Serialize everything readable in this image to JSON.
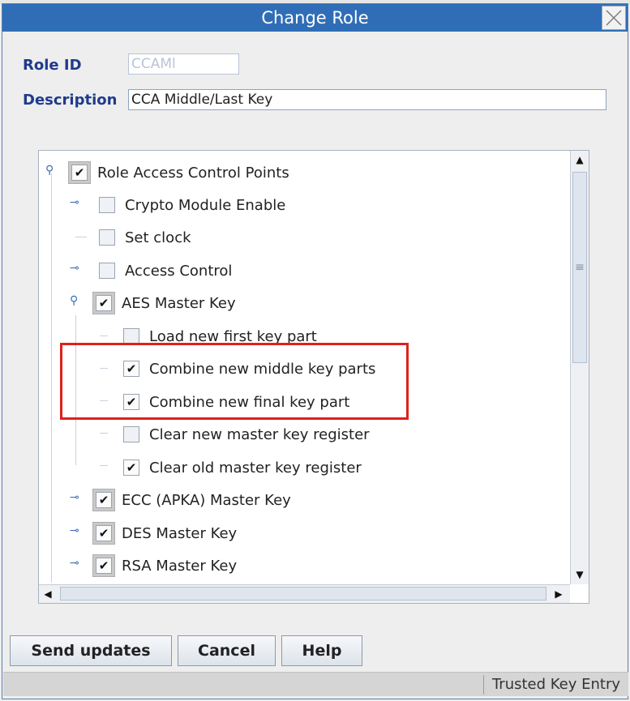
{
  "dialog": {
    "title": "Change Role",
    "role_id_label": "Role ID",
    "role_id_value": "CCAMl",
    "description_label": "Description",
    "description_value": "CCA Middle/Last Key"
  },
  "tree": {
    "root": "Role Access Control Points",
    "items": [
      {
        "label": "Crypto Module Enable",
        "checked": false
      },
      {
        "label": "Set clock",
        "checked": false
      },
      {
        "label": "Access Control",
        "checked": false
      },
      {
        "label": "AES Master Key",
        "checked": true
      },
      {
        "label": "Load new first key part",
        "checked": false
      },
      {
        "label": "Combine new middle key parts",
        "checked": true
      },
      {
        "label": "Combine new final key part",
        "checked": true
      },
      {
        "label": "Clear new master key register",
        "checked": false
      },
      {
        "label": "Clear old master key register",
        "checked": true
      },
      {
        "label": "ECC (APKA) Master Key",
        "checked": true
      },
      {
        "label": "DES Master Key",
        "checked": true
      },
      {
        "label": "RSA Master Key",
        "checked": true
      }
    ]
  },
  "buttons": {
    "send_updates": "Send updates",
    "cancel": "Cancel",
    "help": "Help"
  },
  "status": {
    "text": "Trusted Key Entry"
  },
  "colors": {
    "titlebar": "#2f6eb7",
    "label": "#1f3b8c",
    "highlight": "#e0201b"
  }
}
